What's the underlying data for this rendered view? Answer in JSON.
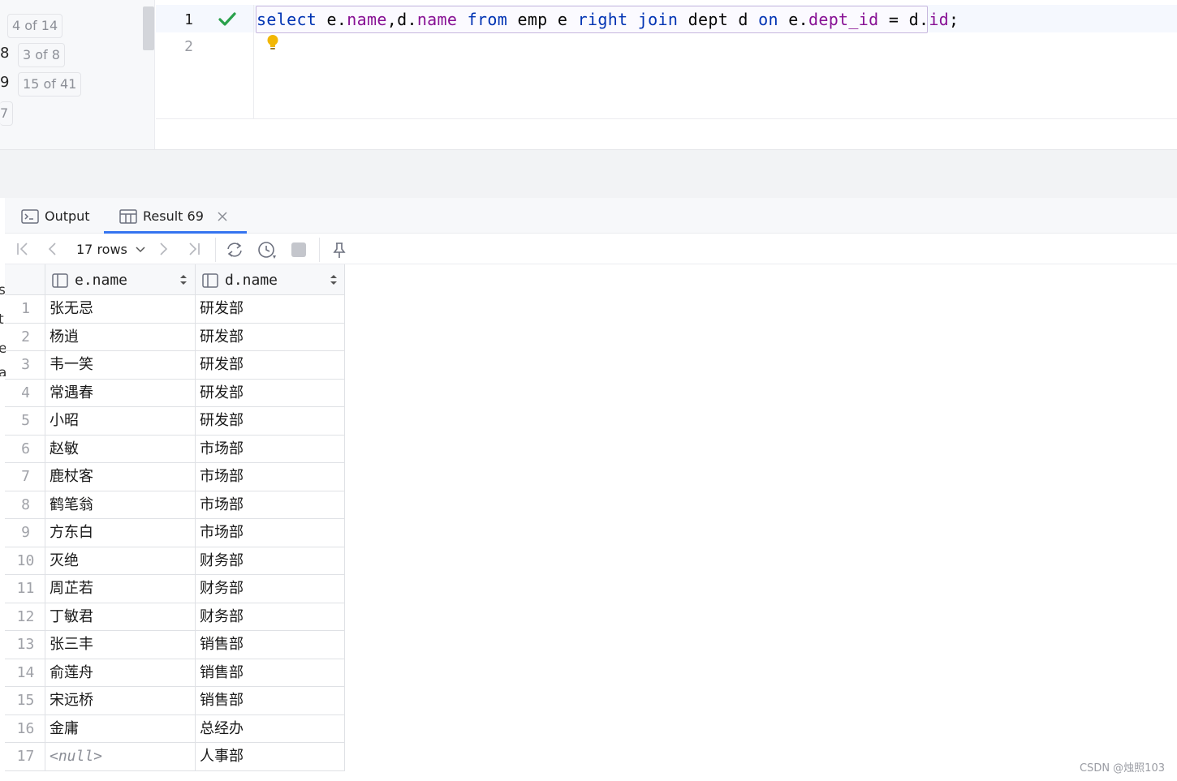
{
  "left_gutter": {
    "rows": [
      {
        "num": "",
        "badge": "4 of 14"
      },
      {
        "num": "8",
        "badge": "3 of 8"
      },
      {
        "num": "9",
        "badge": "15 of 41"
      },
      {
        "num": "",
        "badge": "7"
      }
    ]
  },
  "editor": {
    "line_numbers": [
      "1",
      "2"
    ],
    "sql_tokens": [
      {
        "t": "select",
        "c": "kw"
      },
      {
        "t": " e.",
        "c": ""
      },
      {
        "t": "name",
        "c": "fld"
      },
      {
        "t": ",d.",
        "c": ""
      },
      {
        "t": "name",
        "c": "fld"
      },
      {
        "t": " ",
        "c": ""
      },
      {
        "t": "from",
        "c": "kw"
      },
      {
        "t": " emp e ",
        "c": ""
      },
      {
        "t": "right join",
        "c": "kw"
      },
      {
        "t": " dept d ",
        "c": ""
      },
      {
        "t": "on",
        "c": "kw"
      },
      {
        "t": " e.",
        "c": ""
      },
      {
        "t": "dept_id",
        "c": "fld"
      },
      {
        "t": " = d.",
        "c": ""
      },
      {
        "t": "id",
        "c": "fld"
      },
      {
        "t": ";",
        "c": ""
      }
    ],
    "status_icon": "check-icon",
    "hint_icon": "lightbulb-icon"
  },
  "tabs": {
    "output_label": "Output",
    "result_label": "Result 69"
  },
  "toolbar": {
    "rows_label": "17 rows"
  },
  "grid": {
    "columns": [
      "e.name",
      "d.name"
    ],
    "rows": [
      [
        "1",
        "张无忌",
        "研发部"
      ],
      [
        "2",
        "杨逍",
        "研发部"
      ],
      [
        "3",
        "韦一笑",
        "研发部"
      ],
      [
        "4",
        "常遇春",
        "研发部"
      ],
      [
        "5",
        "小昭",
        "研发部"
      ],
      [
        "6",
        "赵敏",
        "市场部"
      ],
      [
        "7",
        "鹿杖客",
        "市场部"
      ],
      [
        "8",
        "鹤笔翁",
        "市场部"
      ],
      [
        "9",
        "方东白",
        "市场部"
      ],
      [
        "10",
        "灭绝",
        "财务部"
      ],
      [
        "11",
        "周芷若",
        "财务部"
      ],
      [
        "12",
        "丁敏君",
        "财务部"
      ],
      [
        "13",
        "张三丰",
        "销售部"
      ],
      [
        "14",
        "俞莲舟",
        "销售部"
      ],
      [
        "15",
        "宋远桥",
        "销售部"
      ],
      [
        "16",
        "金庸",
        "总经办"
      ],
      [
        "17",
        "<null>",
        "人事部"
      ]
    ]
  },
  "left_edge_chars": [
    "s",
    "t",
    "e",
    "a"
  ],
  "watermark": "CSDN @烛照103",
  "colors": {
    "keyword": "#0033b3",
    "field": "#871094",
    "accent": "#3574f0",
    "check": "#2aa14b"
  }
}
